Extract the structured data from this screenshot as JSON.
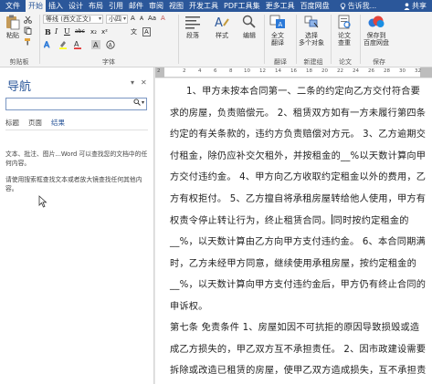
{
  "tabs": [
    {
      "label": "文件",
      "active": false
    },
    {
      "label": "开始",
      "active": true
    },
    {
      "label": "插入",
      "active": false
    },
    {
      "label": "设计",
      "active": false
    },
    {
      "label": "布局",
      "active": false
    },
    {
      "label": "引用",
      "active": false
    },
    {
      "label": "邮件",
      "active": false
    },
    {
      "label": "审阅",
      "active": false
    },
    {
      "label": "视图",
      "active": false
    },
    {
      "label": "开发工具",
      "active": false
    },
    {
      "label": "PDF工具集",
      "active": false
    },
    {
      "label": "更多工具",
      "active": false
    },
    {
      "label": "百度网盘",
      "active": false
    }
  ],
  "tell_me": "告诉我...",
  "share": "共享",
  "ribbon": {
    "clipboard": {
      "paste": "粘贴",
      "label": "剪贴板"
    },
    "font": {
      "font_name": "等线 (西文正文)",
      "font_size": "小四",
      "label": "字体",
      "bold": "B",
      "italic": "I",
      "underline": "U",
      "strike": "abc",
      "subscript": "x₂",
      "superscript": "x²",
      "grow": "A",
      "shrink": "A",
      "case": "Aa",
      "clear": "A",
      "phonetic": "文",
      "border_char": "A"
    },
    "paragraph": {
      "label": "段落"
    },
    "styles": {
      "label": "样式"
    },
    "editing": {
      "label": "编辑"
    },
    "translate": {
      "btn": "全文\n翻译",
      "label": "翻译"
    },
    "select_multi": {
      "btn": "选择\n多个对象",
      "label": "新建组"
    },
    "paper_check": {
      "btn": "论文\n查重",
      "label": "论文"
    },
    "save_baidu": {
      "btn": "保存到\n百度网盘",
      "label": "保存"
    }
  },
  "nav": {
    "title": "导航",
    "search_placeholder": "",
    "tabs": [
      "标题",
      "页面",
      "结果"
    ],
    "hint1": "文本、批注、图片...Word 可以查找您的文档中的任何内容。",
    "hint2": "请使用搜索框查找文本或者放大镜查找任何其他内容。"
  },
  "ruler": {
    "ticks": [
      "2",
      "2",
      "4",
      "6",
      "8",
      "10",
      "12",
      "14",
      "16",
      "18",
      "20",
      "22",
      "24",
      "26",
      "28",
      "30",
      "32"
    ]
  },
  "document": {
    "p1_a": "1、甲方未按本合同第一、二条的约定向乙方交付符合要求的房屋，负责赔偿元。 2、租赁双方如有一方未履行第四条约定的有关条款的，违约方负责赔偿对方元。 3、乙方逾期交付租金，除仍应补交欠租外，并按租金的__%以天数计算向甲方交付违约金。 4、甲方向乙方收取约定租金以外的费用，乙方有权拒付。 5、乙方擅自将承租房屋转给他人使用，甲方有权责令停止转让行为，终止租赁合同。",
    "p1_b": "同时按约定租金的__%，以天数计算由乙方向甲方支付违约金。 6、本合同期满时，乙方未经甲方同意，继续使用承租房屋，按约定租金的__%，以天数计算向甲方支付违约金后，甲方仍有终止合同的申诉权。",
    "p2": "第七条 免责条件 1、房屋如因不可抗拒的原因导致损毁或造成乙方损失的，甲乙双方互不承担责任。 2、因市政建设需要拆除或改造已租赁的房屋，使甲乙双方造成损失，互不承担责任。"
  }
}
